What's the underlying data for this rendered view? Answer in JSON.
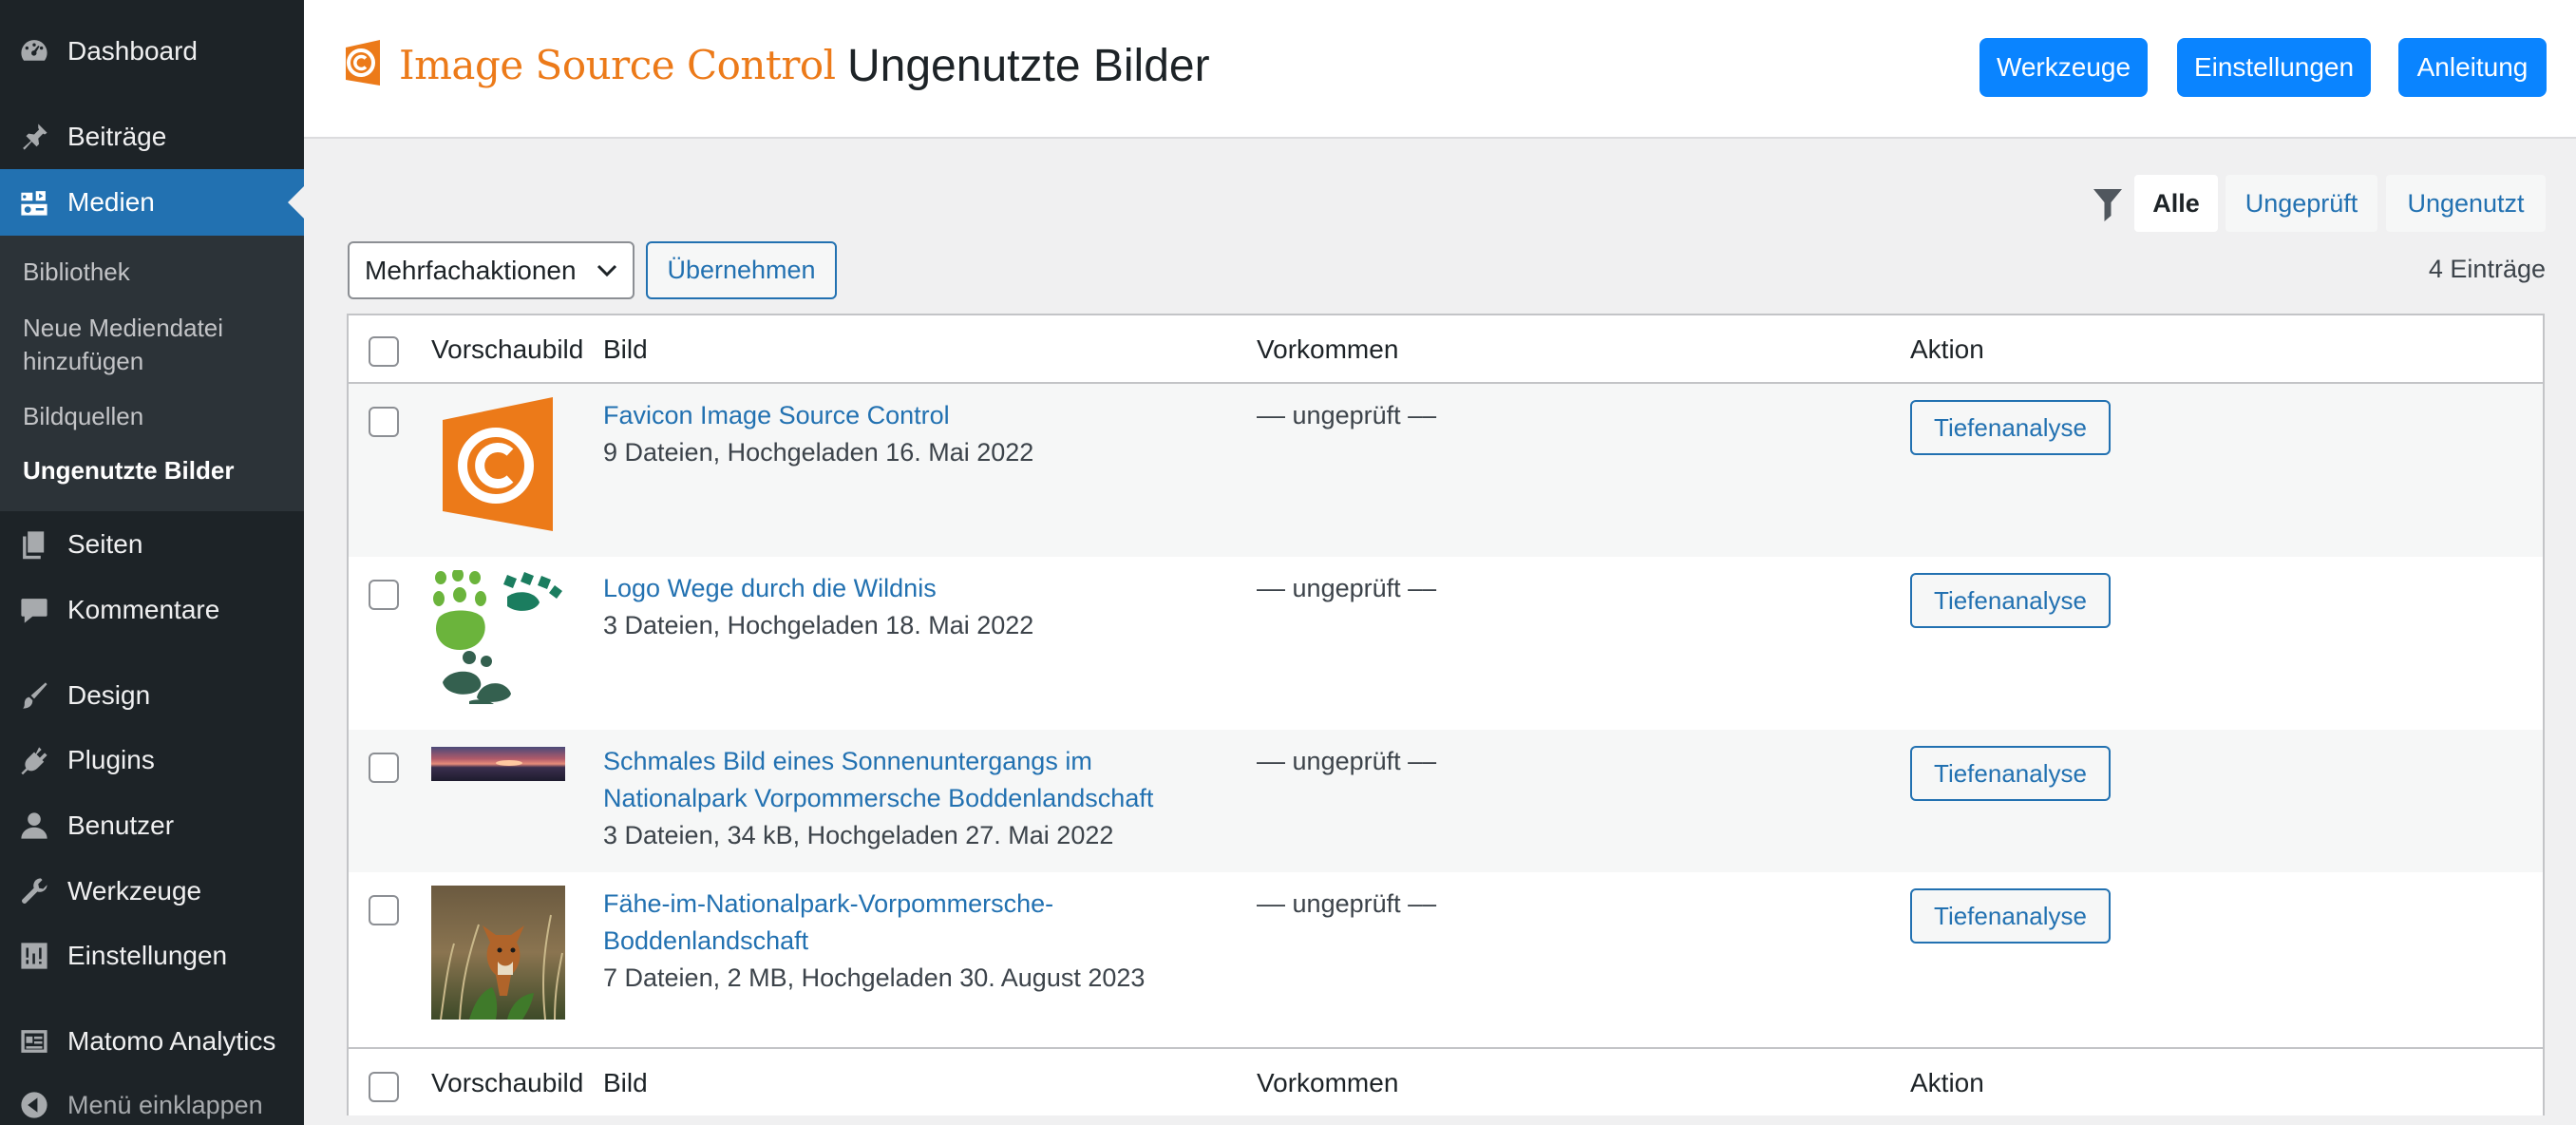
{
  "sidebar": {
    "items": [
      {
        "label": "Dashboard",
        "icon": "dashboard-icon"
      },
      {
        "label": "Beiträge",
        "icon": "pin-icon"
      },
      {
        "label": "Medien",
        "icon": "media-icon"
      },
      {
        "label": "Seiten",
        "icon": "pages-icon"
      },
      {
        "label": "Kommentare",
        "icon": "comment-icon"
      },
      {
        "label": "Design",
        "icon": "brush-icon"
      },
      {
        "label": "Plugins",
        "icon": "plugin-icon"
      },
      {
        "label": "Benutzer",
        "icon": "user-icon"
      },
      {
        "label": "Werkzeuge",
        "icon": "wrench-icon"
      },
      {
        "label": "Einstellungen",
        "icon": "settings-icon"
      },
      {
        "label": "Matomo Analytics",
        "icon": "analytics-icon"
      }
    ],
    "submenu": [
      "Bibliothek",
      "Neue Mediendatei",
      "hinzufügen",
      "Bildquellen",
      "Ungenutzte Bilder"
    ],
    "collapse_label": "Menü einklappen"
  },
  "header": {
    "brand": "Image Source Control",
    "title": "Ungenutzte Bilder",
    "buttons": [
      "Werkzeuge",
      "Einstellungen",
      "Anleitung"
    ],
    "accent": "#ec7a19",
    "button_color": "#0a84ff"
  },
  "filters": {
    "items": [
      "Alle",
      "Ungeprüft",
      "Ungenutzt"
    ],
    "active": "Alle"
  },
  "bulk": {
    "select_value": "Mehrfachaktionen",
    "apply_label": "Übernehmen",
    "count": "4 Einträge"
  },
  "table": {
    "columns": [
      "Vorschaubild",
      "Bild",
      "Vorkommen",
      "Aktion"
    ],
    "rows": [
      {
        "title": "Favicon Image Source Control",
        "meta": "9 Dateien, Hochgeladen 16. Mai 2022",
        "occurrence": "–– ungeprüft ––",
        "action": "Tiefenanalyse"
      },
      {
        "title": "Logo Wege durch die Wildnis",
        "meta": "3 Dateien, Hochgeladen 18. Mai 2022",
        "occurrence": "–– ungeprüft ––",
        "action": "Tiefenanalyse"
      },
      {
        "title_lines": [
          "Schmales Bild eines Sonnenuntergangs im",
          "Nationalpark Vorpommersche Boddenlandschaft"
        ],
        "meta": "3 Dateien, 34 kB, Hochgeladen 27. Mai 2022",
        "occurrence": "–– ungeprüft ––",
        "action": "Tiefenanalyse"
      },
      {
        "title_lines": [
          "Fähe-im-Nationalpark-Vorpommersche-",
          "Boddenlandschaft"
        ],
        "meta": "7 Dateien, 2 MB, Hochgeladen 30. August 2023",
        "occurrence": "–– ungeprüft ––",
        "action": "Tiefenanalyse"
      }
    ]
  }
}
